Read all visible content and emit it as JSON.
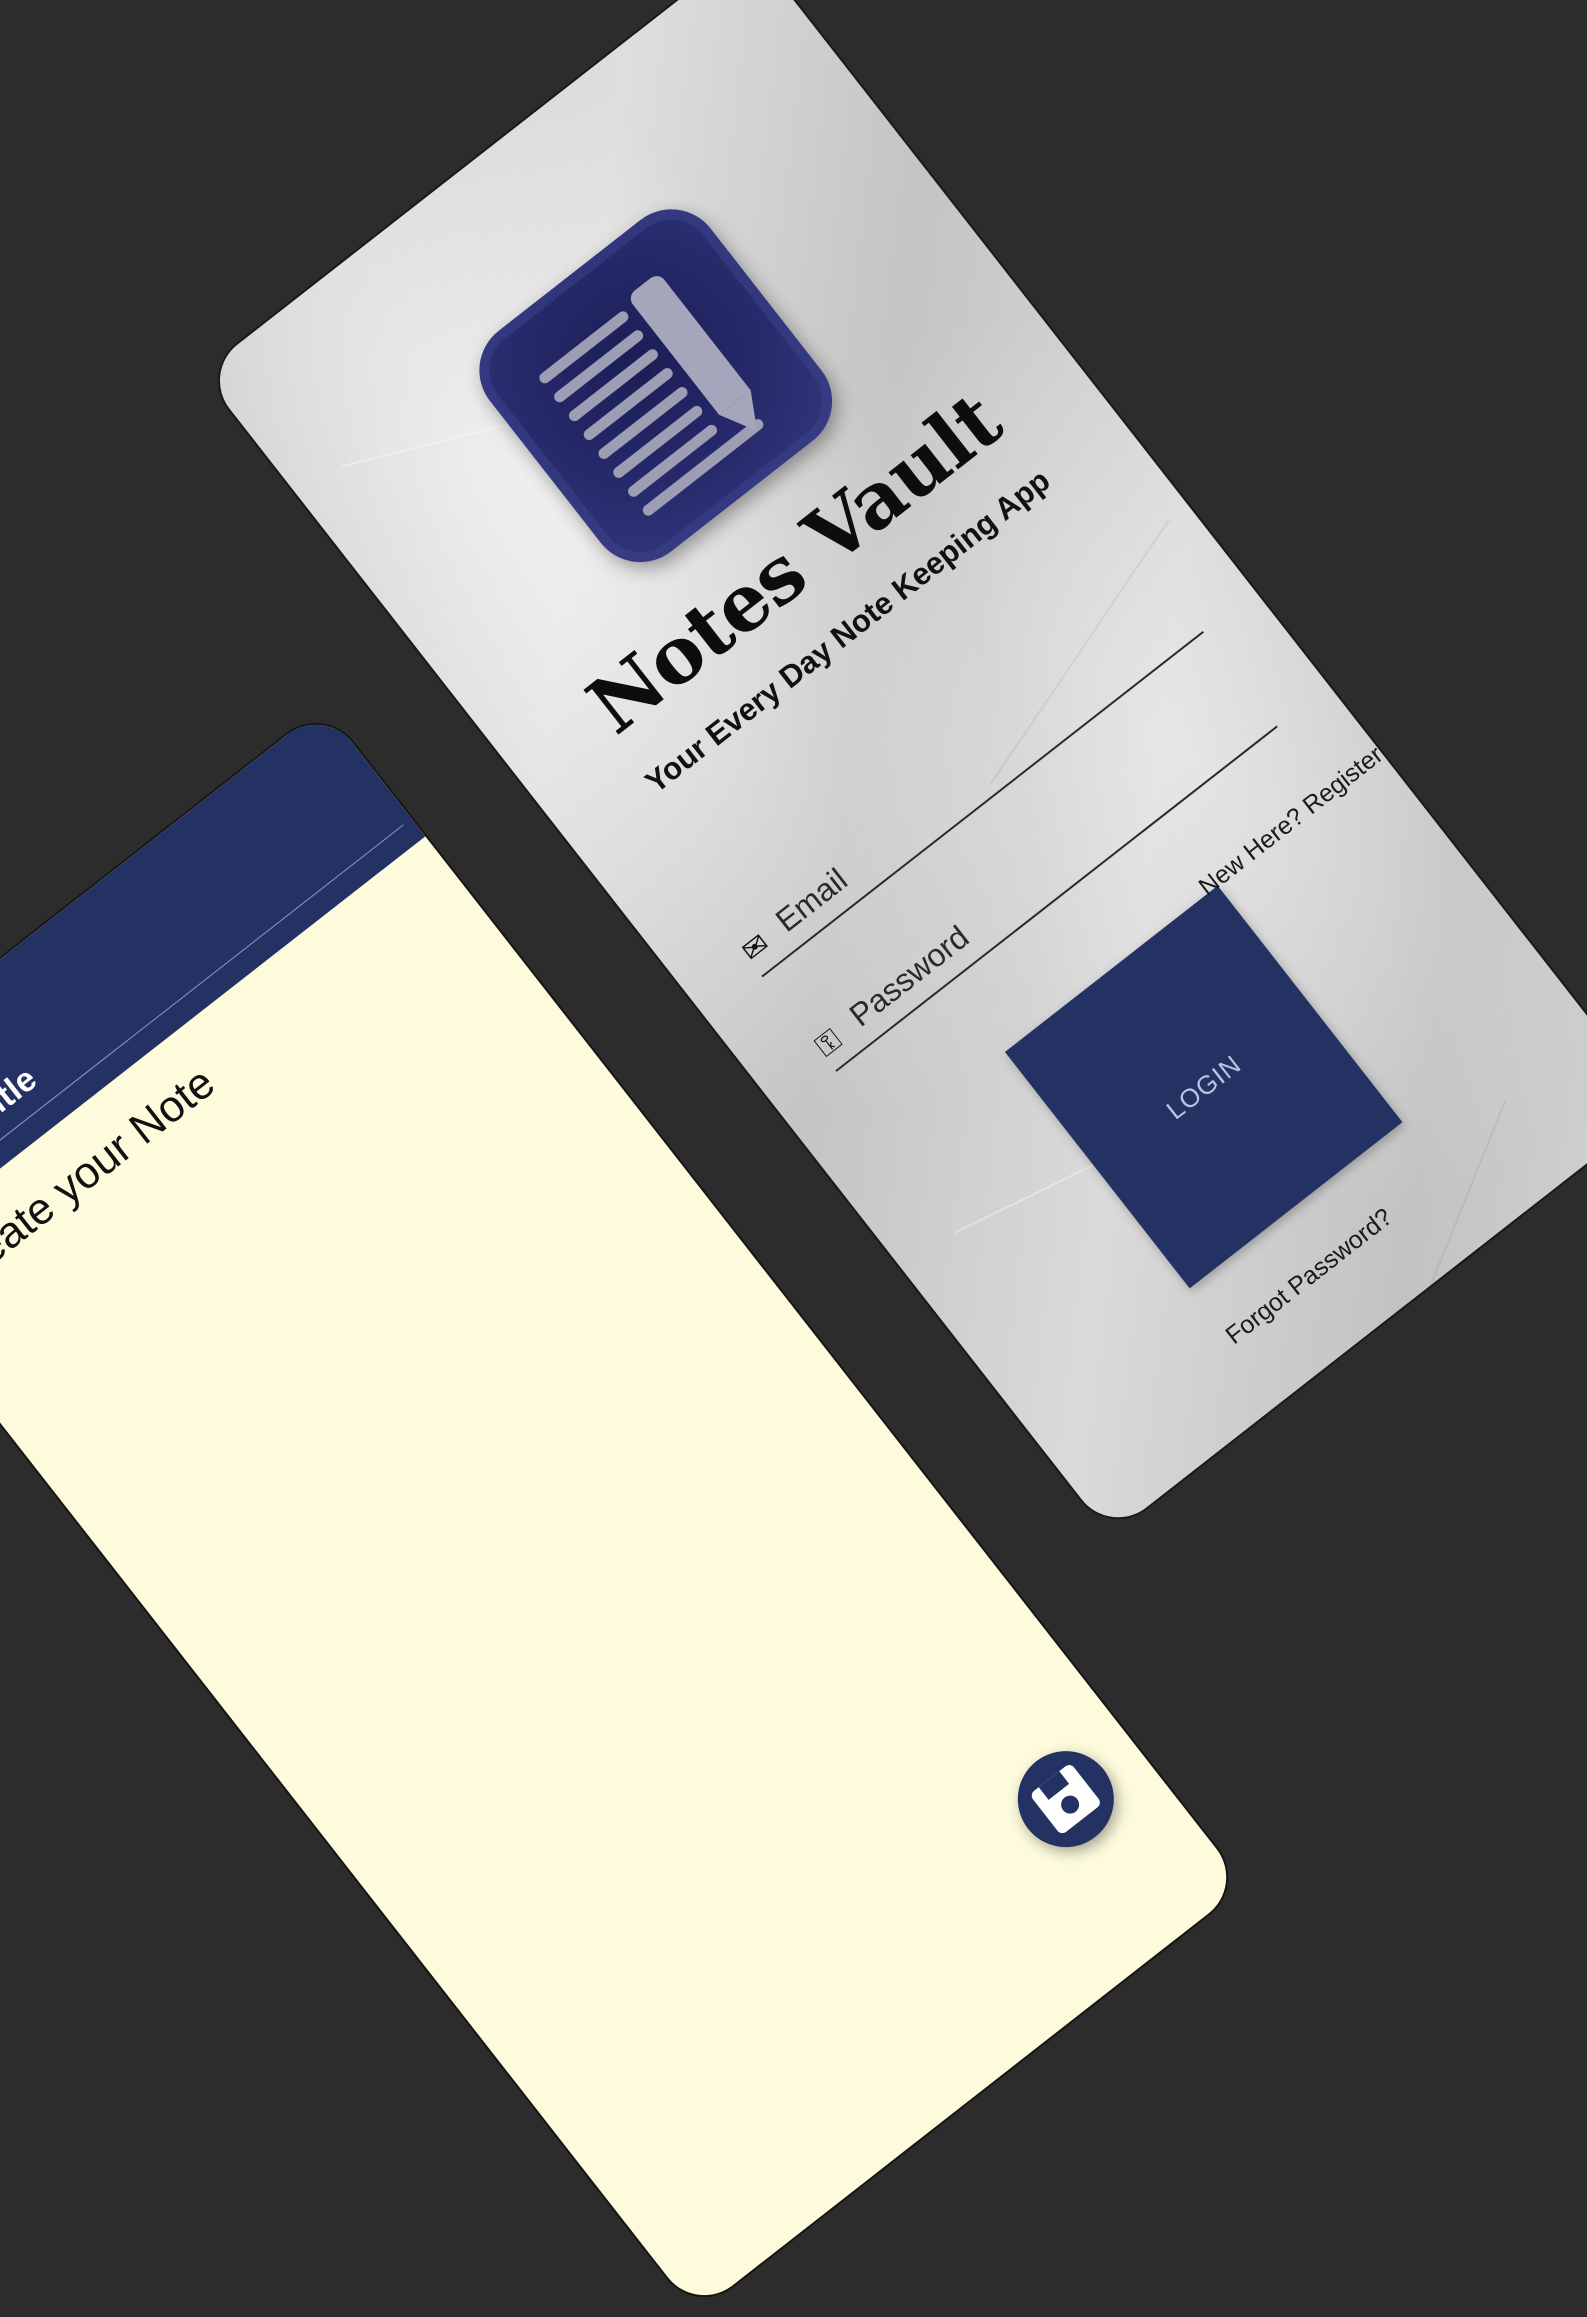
{
  "login_screen": {
    "app_name": "Notes Vault",
    "tagline": "Your Every Day Note Keeping App",
    "email_placeholder": "Email",
    "password_placeholder": "Password",
    "login_label": "LOGIN",
    "forgot_password_label": "Forgot Password?",
    "register_label": "New Here? Register",
    "icons": {
      "logo": "notes-logo-icon",
      "email": "envelope-icon",
      "password": "key-icon"
    },
    "colors": {
      "accent": "#243263",
      "logo_bg": "#262a6b"
    }
  },
  "note_screen": {
    "title_placeholder": "Note title",
    "body_placeholder": "Create your Note",
    "icons": {
      "back": "back-arrow-icon",
      "save": "floppy-disk-icon"
    },
    "colors": {
      "header": "#233262",
      "paper": "#fdfbdc"
    }
  }
}
